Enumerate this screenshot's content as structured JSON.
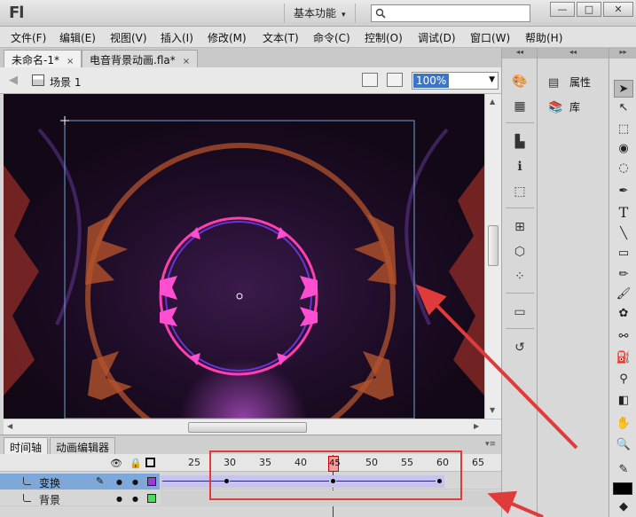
{
  "title_bar": {
    "logo": "Fl",
    "workspace_label": "基本功能",
    "search_placeholder": "",
    "buttons": {
      "minimize": "—",
      "restore": "□",
      "close": "✕"
    }
  },
  "menu": [
    "文件(F)",
    "编辑(E)",
    "视图(V)",
    "插入(I)",
    "修改(M)",
    "文本(T)",
    "命令(C)",
    "控制(O)",
    "调试(D)",
    "窗口(W)",
    "帮助(H)"
  ],
  "doc_tabs": [
    {
      "label": "未命名-1*",
      "close": "×"
    },
    {
      "label": "电音背景动画.fla*",
      "close": "×"
    }
  ],
  "edit_bar": {
    "scene_label": "场景 1",
    "zoom_value": "100%"
  },
  "timeline": {
    "tabs": [
      "时间轴",
      "动画编辑器"
    ],
    "ruler": [
      "25",
      "30",
      "35",
      "40",
      "45",
      "50",
      "55",
      "60",
      "65"
    ],
    "current_frame": "45",
    "layers": [
      {
        "name": "变换",
        "color": "#9a3cd6",
        "selected": true
      },
      {
        "name": "背景",
        "color": "#4ddc5c",
        "selected": false
      }
    ]
  },
  "panels": {
    "properties_label": "属性",
    "library_label": "库"
  },
  "icons": {
    "dock": [
      "color-icon",
      "swatches-icon",
      "align-icon",
      "info-icon",
      "transform-icon",
      "components-icon",
      "library-icon",
      "motion-presets-icon",
      "history-icon"
    ],
    "tools": [
      "selection-tool",
      "subselection-tool",
      "free-transform-tool",
      "3d-rotation-tool",
      "lasso-tool",
      "pen-tool",
      "text-tool",
      "line-tool",
      "rectangle-tool",
      "pencil-tool",
      "brush-tool",
      "deco-tool",
      "bone-tool",
      "paint-bucket-tool",
      "eyedropper-tool",
      "eraser-tool",
      "hand-tool",
      "zoom-tool"
    ]
  },
  "colors": {
    "layer_selected_bg": "#7ea7da",
    "tween_fill": "#c7c3ef",
    "annotation_red": "#e03b3b",
    "playhead": "#d40000"
  }
}
